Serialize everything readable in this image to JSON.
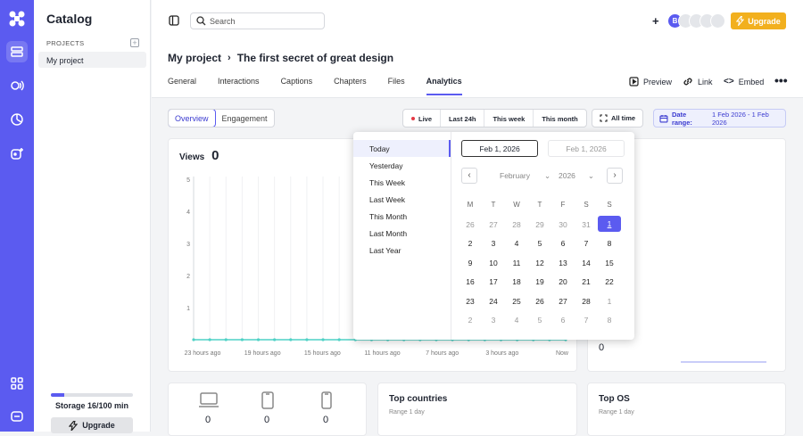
{
  "sidebar": {
    "title": "Catalog",
    "projects_label": "PROJECTS",
    "project_item": "My project",
    "storage": {
      "label": "Storage 16/100 min",
      "used_fraction": 0.16
    },
    "upgrade_label": "Upgrade"
  },
  "topbar": {
    "search_placeholder": "Search",
    "avatar_initial": "B",
    "upgrade_label": "Upgrade"
  },
  "header": {
    "breadcrumb_root": "My project",
    "breadcrumb_page": "The first secret of great design",
    "tabs": [
      "General",
      "Interactions",
      "Captions",
      "Chapters",
      "Files",
      "Analytics"
    ],
    "active_tab": "Analytics",
    "actions": {
      "preview": "Preview",
      "link": "Link",
      "embed": "Embed"
    }
  },
  "controls": {
    "view_tabs": [
      "Overview",
      "Engagement"
    ],
    "ranges": [
      "Live",
      "Last 24h",
      "This week",
      "This month"
    ],
    "all_time": "All time",
    "date_range_label": "Date range:",
    "date_range_value": "1 Feb 2026 - 1 Feb 2026"
  },
  "views": {
    "title": "Views",
    "count": "0"
  },
  "chart_data": {
    "type": "line",
    "xlabel": "",
    "ylabel": "",
    "x": [
      "23 hours ago",
      "19 hours ago",
      "15 hours ago",
      "11 hours ago",
      "7 hours ago",
      "3 hours ago",
      "Now"
    ],
    "y_ticks": [
      "1",
      "2",
      "3",
      "4",
      "5"
    ],
    "ylim": [
      0,
      5
    ],
    "series": [
      {
        "values": [
          0,
          0,
          0,
          0,
          0,
          0,
          0,
          0,
          0,
          0,
          0,
          0,
          0,
          0,
          0,
          0,
          0,
          0,
          0,
          0,
          0,
          0,
          0,
          0
        ]
      }
    ],
    "color": "#4fd1c5",
    "grid": true
  },
  "datepicker": {
    "presets": [
      "Today",
      "Yesterday",
      "This Week",
      "Last Week",
      "This Month",
      "Last Month",
      "Last Year"
    ],
    "selected_preset": "Today",
    "start_date": "Feb 1, 2026",
    "end_date": "Feb 1, 2026",
    "month": "February",
    "year": "2026",
    "weekdays": [
      "M",
      "T",
      "W",
      "T",
      "F",
      "S",
      "S"
    ],
    "weeks": [
      [
        "26",
        "27",
        "28",
        "29",
        "30",
        "31",
        "1"
      ],
      [
        "2",
        "3",
        "4",
        "5",
        "6",
        "7",
        "8"
      ],
      [
        "9",
        "10",
        "11",
        "12",
        "13",
        "14",
        "15"
      ],
      [
        "16",
        "17",
        "18",
        "19",
        "20",
        "21",
        "22"
      ],
      [
        "23",
        "24",
        "25",
        "26",
        "27",
        "28",
        "1"
      ],
      [
        "2",
        "3",
        "4",
        "5",
        "6",
        "7",
        "8"
      ]
    ]
  },
  "stats": {
    "device_counts": [
      "0",
      "0",
      "0"
    ],
    "side_count": "0",
    "top_countries": {
      "title": "Top countries",
      "range": "Range 1 day"
    },
    "top_os": {
      "title": "Top OS",
      "range": "Range 1 day"
    }
  }
}
